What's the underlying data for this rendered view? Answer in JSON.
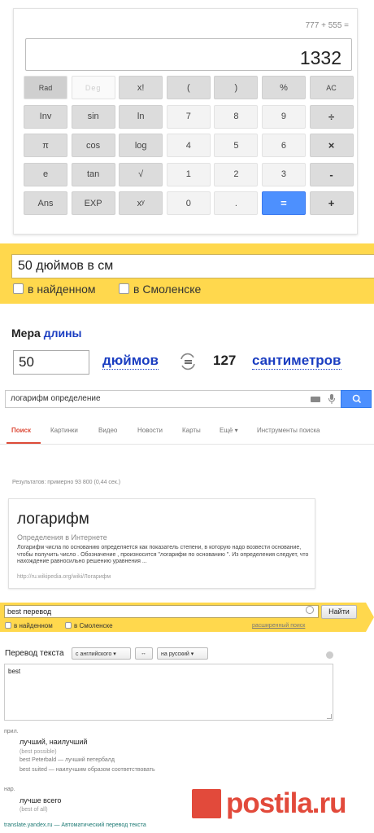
{
  "calculator": {
    "expression": "777 + 555 =",
    "display": "1332",
    "keys": [
      {
        "label": "Rad",
        "kind": "rad"
      },
      {
        "label": "Deg",
        "kind": "deg"
      },
      {
        "label": "x!",
        "kind": "fn"
      },
      {
        "label": "(",
        "kind": "fn"
      },
      {
        "label": ")",
        "kind": "fn"
      },
      {
        "label": "%",
        "kind": "fn"
      },
      {
        "label": "AC",
        "kind": "fn small"
      },
      {
        "label": "Inv",
        "kind": "fn"
      },
      {
        "label": "sin",
        "kind": "fn"
      },
      {
        "label": "ln",
        "kind": "fn"
      },
      {
        "label": "7",
        "kind": "num"
      },
      {
        "label": "8",
        "kind": "num"
      },
      {
        "label": "9",
        "kind": "num"
      },
      {
        "label": "÷",
        "kind": "op"
      },
      {
        "label": "π",
        "kind": "fn"
      },
      {
        "label": "cos",
        "kind": "fn"
      },
      {
        "label": "log",
        "kind": "fn"
      },
      {
        "label": "4",
        "kind": "num"
      },
      {
        "label": "5",
        "kind": "num"
      },
      {
        "label": "6",
        "kind": "num"
      },
      {
        "label": "×",
        "kind": "op"
      },
      {
        "label": "e",
        "kind": "fn"
      },
      {
        "label": "tan",
        "kind": "fn"
      },
      {
        "label": "√",
        "kind": "fn"
      },
      {
        "label": "1",
        "kind": "num"
      },
      {
        "label": "2",
        "kind": "num"
      },
      {
        "label": "3",
        "kind": "num"
      },
      {
        "label": "-",
        "kind": "op"
      },
      {
        "label": "Ans",
        "kind": "fn"
      },
      {
        "label": "EXP",
        "kind": "fn"
      },
      {
        "label": "xʸ",
        "kind": "fn"
      },
      {
        "label": "0",
        "kind": "num"
      },
      {
        "label": ".",
        "kind": "num"
      },
      {
        "label": "=",
        "kind": "eq"
      },
      {
        "label": "+",
        "kind": "op"
      }
    ]
  },
  "yandex_search_1": {
    "query": "50 дюймов в см",
    "option_found": "в найденном",
    "option_city": "в Смоленске"
  },
  "converter": {
    "title_prefix": "Мера",
    "title_link": "длины",
    "amount": "50",
    "from_unit": "дюймов",
    "result_value": "127",
    "to_unit": "сантиметров"
  },
  "google": {
    "query": "логарифм определение",
    "tabs": [
      "Поиск",
      "Картинки",
      "Видео",
      "Новости",
      "Карты",
      "Ещё ▾",
      "Инструменты поиска"
    ],
    "stats": "Результатов: примерно 93 800 (0,44 сек.)",
    "card": {
      "term": "логарифм",
      "subtitle": "Определения в Интернете",
      "definition": "Логарифм числа по основанию определяется как показатель степени, в которую надо возвести основание, чтобы получить число . Обозначение , произносится \"логарифм по основанию \". Из определения следует, что нахождение равносильно решению уравнения ...",
      "url": "http://ru.wikipedia.org/wiki/Логарифм"
    }
  },
  "yandex_search_2": {
    "query": "best перевод",
    "search_button": "Найти",
    "option_found": "в найденном",
    "option_city": "в Смоленске",
    "advanced": "расширенный поиск"
  },
  "translate": {
    "title": "Перевод текста",
    "from_lang": "с английского ▾",
    "swap": "↔",
    "to_lang": "на русский ▾",
    "source_text": "best",
    "adj_label": "прил.",
    "adj_main": "лучший, наилучший",
    "adj_sub": "(best possible)",
    "adj_ex1": "best Peterbald — лучший петербалд",
    "adj_ex2": "best suited — наилучшим образом соответствовать",
    "adv_label": "нар.",
    "adv_main": "лучше всего",
    "adv_sub": "(best of all)",
    "footer": "translate.yandex.ru — Автоматический перевод текста"
  },
  "watermark": {
    "text": "postila.ru"
  },
  "colors": {
    "google_blue": "#4d90fe",
    "yandex_yellow": "#ffd84d",
    "link_blue": "#1a3dc1",
    "google_red": "#dd4b39",
    "postila_red": "#e24a3b"
  }
}
